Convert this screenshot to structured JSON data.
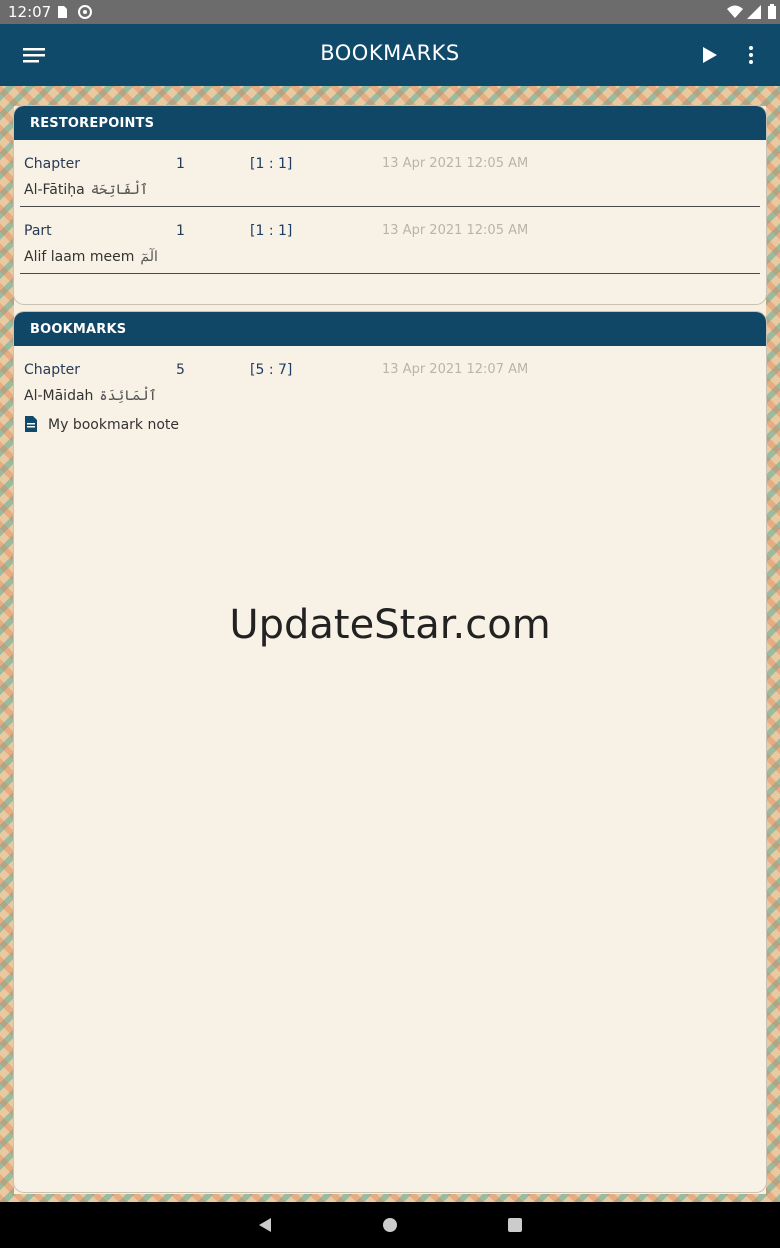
{
  "status_bar": {
    "time": "12:07",
    "icons": [
      "sd-card-icon",
      "data-saver-icon",
      "wifi-icon",
      "signal-icon",
      "battery-icon"
    ]
  },
  "app_bar": {
    "title": "BOOKMARKS",
    "icons": [
      "menu-icon",
      "play-icon",
      "more-vert-icon"
    ]
  },
  "restorepoints": {
    "header": "RESTOREPOINTS",
    "items": [
      {
        "type": "Chapter",
        "number": "1",
        "ref": "[1 : 1]",
        "date": "13 Apr 2021 12:05 AM",
        "name": "Al-Fātiḥa",
        "arabic": "ٱلْفَاتِحَة"
      },
      {
        "type": "Part",
        "number": "1",
        "ref": "[1 : 1]",
        "date": "13 Apr 2021 12:05 AM",
        "name": "Alif laam meem",
        "arabic": "الٓمٓ"
      }
    ]
  },
  "bookmarks": {
    "header": "BOOKMARKS",
    "items": [
      {
        "type": "Chapter",
        "number": "5",
        "ref": "[5 : 7]",
        "date": "13 Apr 2021 12:07 AM",
        "name": "Al-Māidah",
        "arabic": "ٱلْمَائِدَة",
        "note": "My bookmark note"
      }
    ]
  },
  "watermark": "UpdateStar.com",
  "colors": {
    "status_bar": "#6c6c6c",
    "app_bar": "#0f4a6b",
    "card_header": "#104766",
    "card_bg": "#f8f2e6"
  }
}
